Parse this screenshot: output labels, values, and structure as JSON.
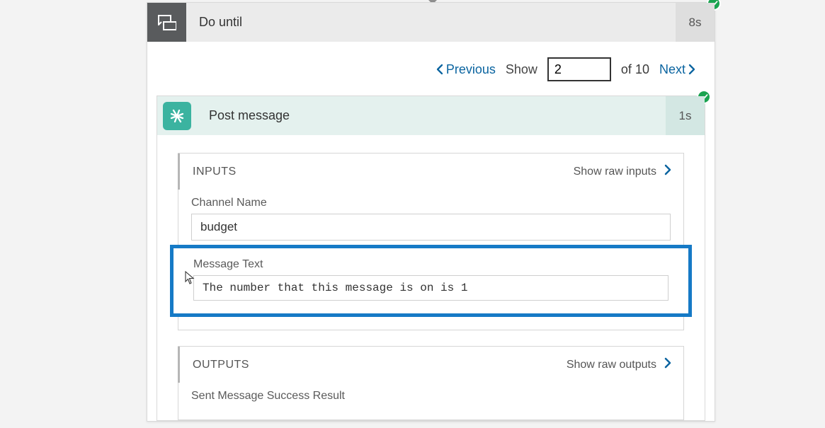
{
  "outer": {
    "title": "Do until",
    "duration": "8s",
    "status": "success"
  },
  "pagination": {
    "previous_label": "Previous",
    "show_label": "Show",
    "current": "2",
    "of_label": "of",
    "total": "10",
    "next_label": "Next"
  },
  "inner": {
    "title": "Post message",
    "duration": "1s",
    "status": "success"
  },
  "inputs": {
    "section_title": "INPUTS",
    "show_raw_label": "Show raw inputs",
    "fields": {
      "channel_label": "Channel Name",
      "channel_value": "budget",
      "message_label": "Message Text",
      "message_value": "The number that this message is on is 1"
    }
  },
  "outputs": {
    "section_title": "OUTPUTS",
    "show_raw_label": "Show raw outputs",
    "result_label": "Sent Message Success Result"
  }
}
